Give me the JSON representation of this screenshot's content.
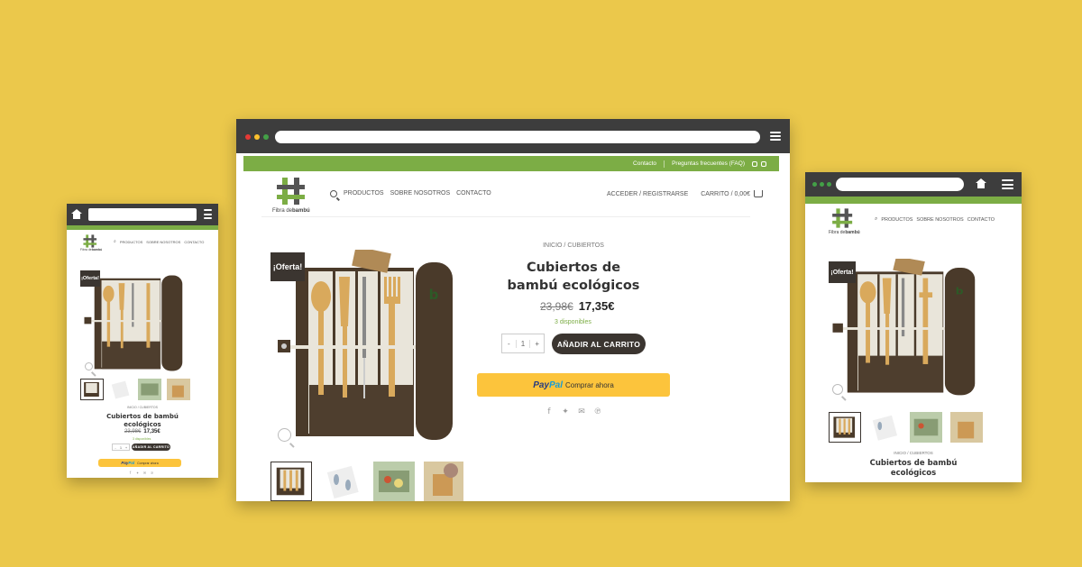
{
  "brand": {
    "logo_text_small": "Fibra de",
    "logo_text_bold": "bambú"
  },
  "topbar": {
    "links": [
      "Contacto",
      "Preguntas frecuentes (FAQ)"
    ]
  },
  "nav": {
    "items": [
      "PRODUCTOS",
      "SOBRE NOSOTROS",
      "CONTACTO"
    ],
    "account": "ACCEDER / REGISTRARSE",
    "cart": "CARRITO / 0,00€"
  },
  "product": {
    "breadcrumb": "INICIO / CUBIERTOS",
    "title": "Cubiertos de bambú ecológicos",
    "old_price": "23,98€",
    "new_price": "17,35€",
    "stock": "3 disponibles",
    "sale_badge": "¡Oferta!",
    "quantity": "1",
    "qty_minus": "-",
    "qty_plus": "+",
    "add_to_cart": "AÑADIR AL CARRITO",
    "paypal_brand_1": "Pay",
    "paypal_brand_2": "Pal",
    "paypal_cta": "Comprar ahora"
  },
  "colors": {
    "background": "#ebc84b",
    "green": "#7cad45",
    "dark": "#3d3d3d",
    "button": "#3b3530",
    "paypal": "#fcc43c"
  },
  "icons": {
    "share": [
      "facebook-icon",
      "twitter-icon",
      "email-icon",
      "pinterest-icon"
    ]
  }
}
